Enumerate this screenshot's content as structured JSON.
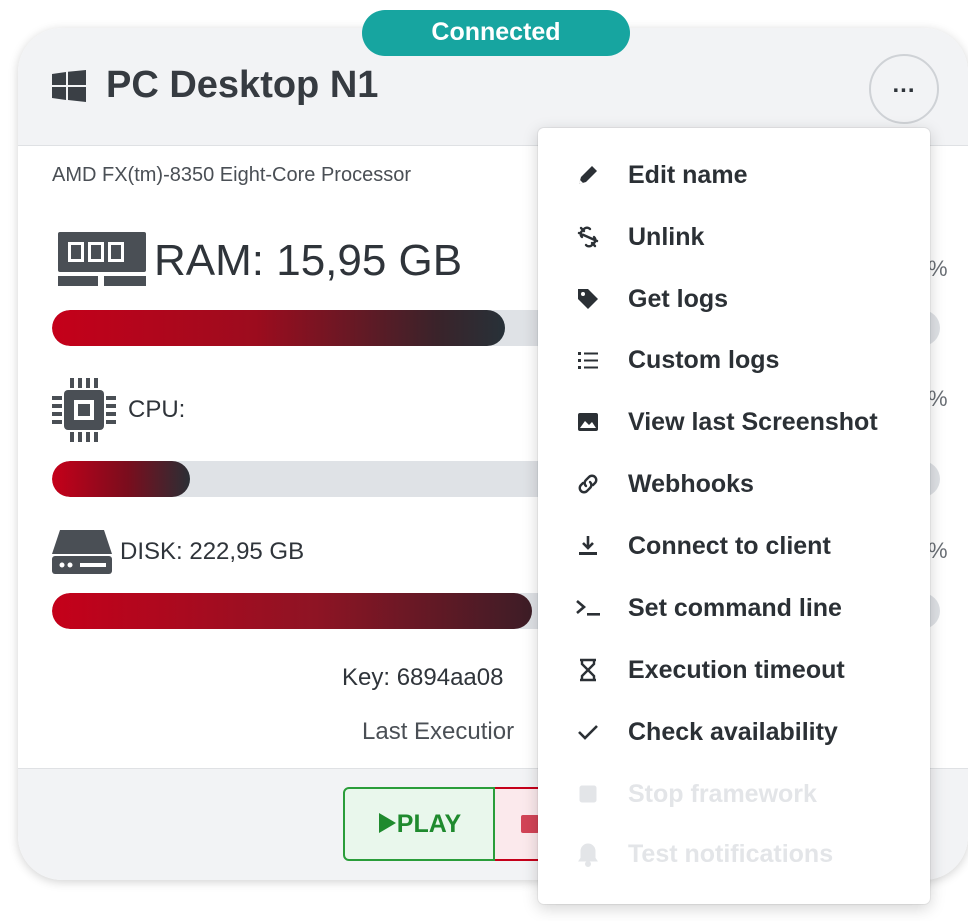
{
  "status": {
    "label": "Connected",
    "color": "#17a5a0"
  },
  "device": {
    "title": "PC Desktop N1",
    "os_icon": "windows-icon",
    "processor": "AMD FX(tm)-8350 Eight-Core Processor",
    "menu_label": "..."
  },
  "resources": {
    "ram": {
      "label": "RAM: 15,95 GB",
      "icon": "ram-icon",
      "usage_fraction": 0.51
    },
    "cpu": {
      "label": "CPU:",
      "icon": "cpu-icon",
      "usage_fraction": 0.155
    },
    "disk": {
      "label": "DISK: 222,95 GB",
      "icon": "disk-icon",
      "usage_fraction": 0.54
    },
    "edge_fragment": "%"
  },
  "info": {
    "key": "Key: 6894aa08",
    "last_execution": "Last Executior"
  },
  "actions": {
    "play_label": "PLAY",
    "play_icon": "play-icon",
    "stop_icon": "stop-icon"
  },
  "menu": {
    "items": [
      {
        "label": "Edit name",
        "icon": "pencil-icon",
        "enabled": true
      },
      {
        "label": "Unlink",
        "icon": "unlink-icon",
        "enabled": true
      },
      {
        "label": "Get logs",
        "icon": "tag-icon",
        "enabled": true
      },
      {
        "label": "Custom logs",
        "icon": "list-icon",
        "enabled": true
      },
      {
        "label": "View last Screenshot",
        "icon": "image-icon",
        "enabled": true
      },
      {
        "label": "Webhooks",
        "icon": "link-icon",
        "enabled": true
      },
      {
        "label": "Connect to client",
        "icon": "download-icon",
        "enabled": true
      },
      {
        "label": "Set command line",
        "icon": "terminal-icon",
        "enabled": true
      },
      {
        "label": "Execution timeout",
        "icon": "hourglass-icon",
        "enabled": true
      },
      {
        "label": "Check availability",
        "icon": "check-icon",
        "enabled": true
      },
      {
        "label": "Stop framework",
        "icon": "stop-icon",
        "enabled": false
      },
      {
        "label": "Test notifications",
        "icon": "bell-icon",
        "enabled": false
      }
    ]
  }
}
